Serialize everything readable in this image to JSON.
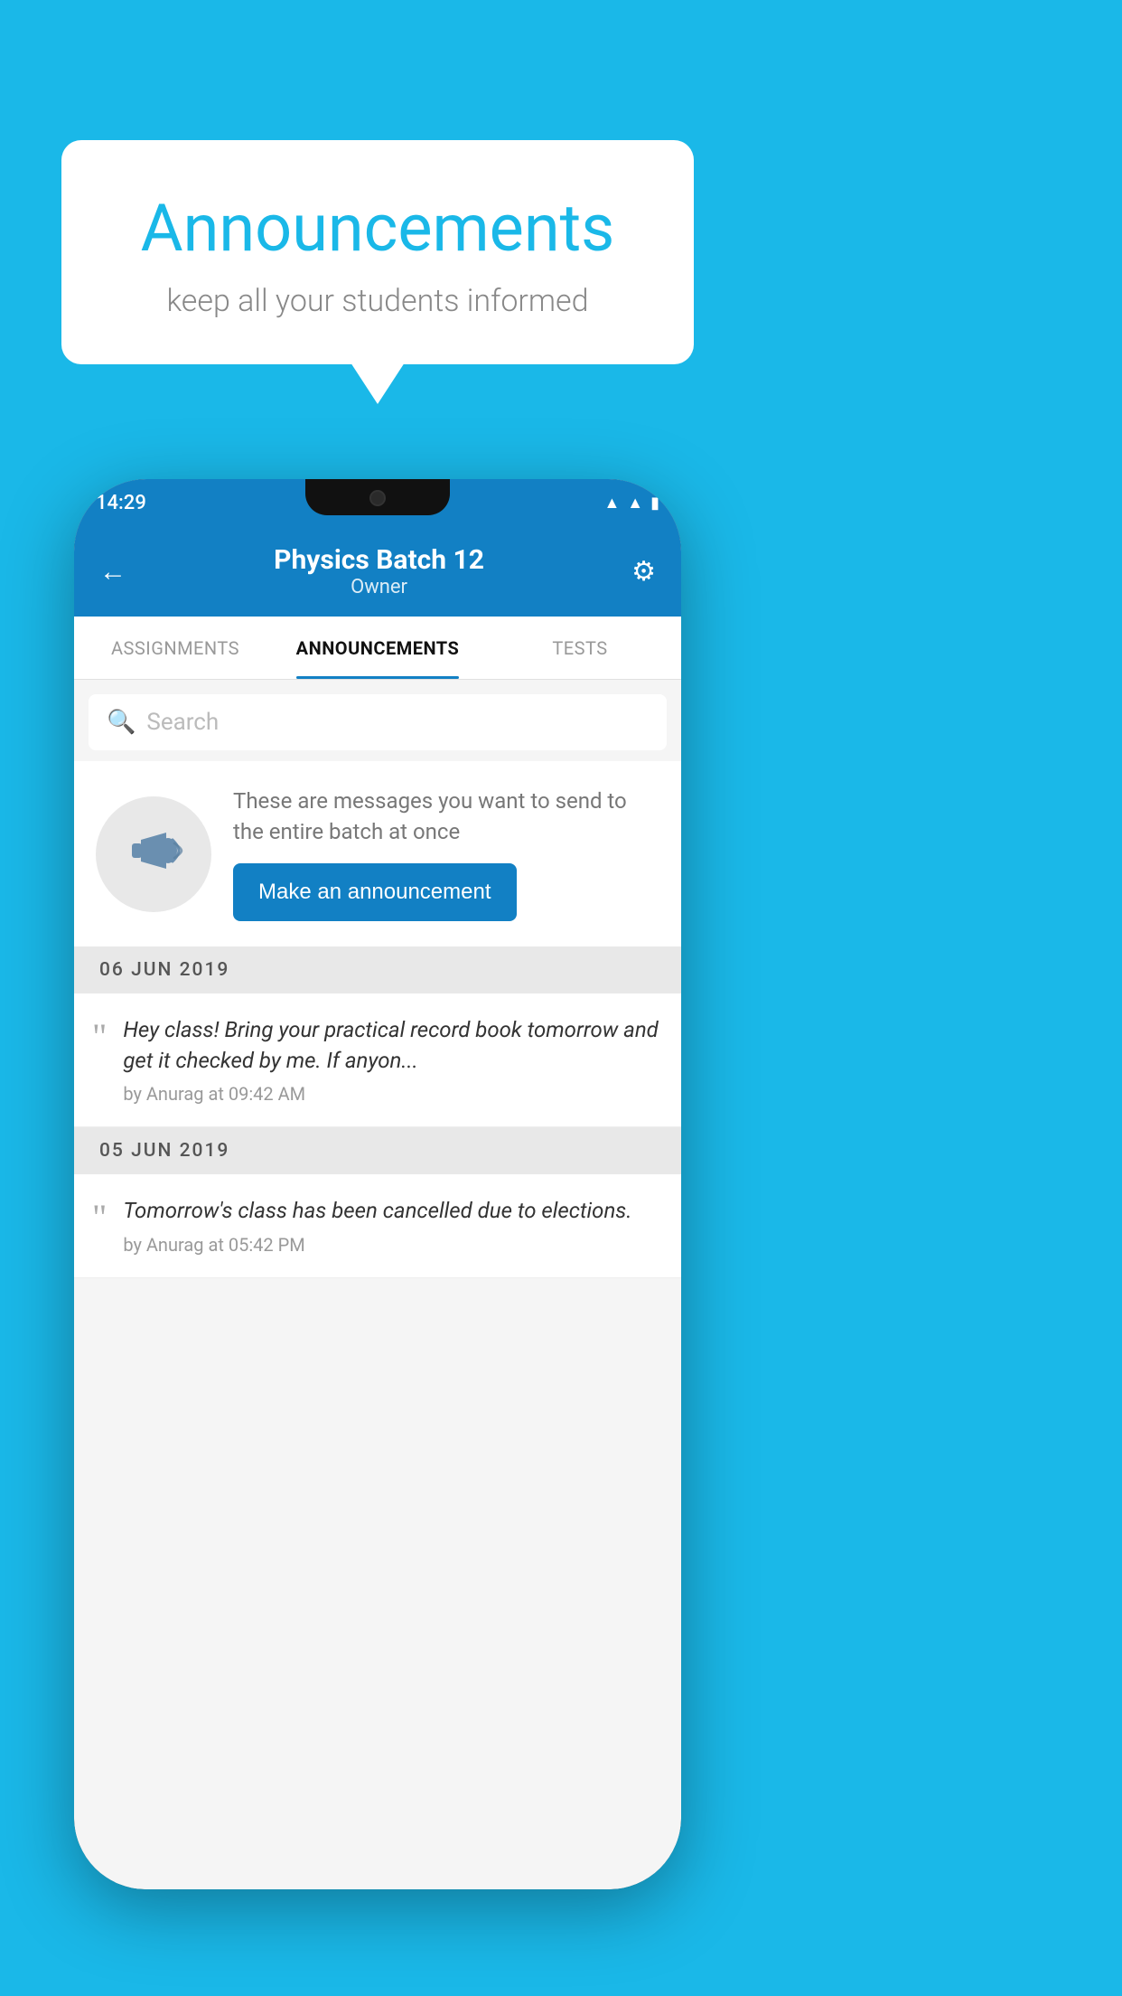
{
  "background_color": "#1ab8e8",
  "speech_bubble": {
    "title": "Announcements",
    "subtitle": "keep all your students informed"
  },
  "phone": {
    "status_bar": {
      "time": "14:29",
      "icons": [
        "wifi",
        "signal",
        "battery"
      ]
    },
    "app_bar": {
      "back_label": "←",
      "batch_name": "Physics Batch 12",
      "batch_role": "Owner",
      "settings_label": "⚙"
    },
    "tabs": [
      {
        "label": "ASSIGNMENTS",
        "active": false
      },
      {
        "label": "ANNOUNCEMENTS",
        "active": true
      },
      {
        "label": "TESTS",
        "active": false
      }
    ],
    "search": {
      "placeholder": "Search"
    },
    "promo": {
      "description": "These are messages you want to send to the entire batch at once",
      "button_label": "Make an announcement"
    },
    "announcements": [
      {
        "date": "06  JUN  2019",
        "messages": [
          {
            "text": "Hey class! Bring your practical record book tomorrow and get it checked by me. If anyon...",
            "meta": "by Anurag at 09:42 AM"
          }
        ]
      },
      {
        "date": "05  JUN  2019",
        "messages": [
          {
            "text": "Tomorrow's class has been cancelled due to elections.",
            "meta": "by Anurag at 05:42 PM"
          }
        ]
      }
    ]
  }
}
